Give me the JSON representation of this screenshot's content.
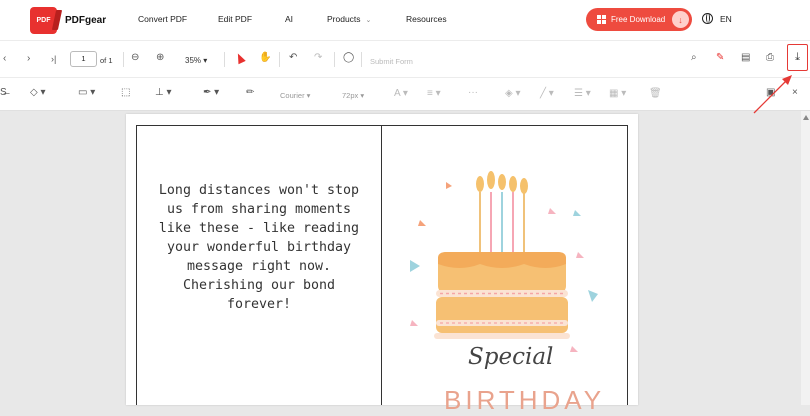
{
  "header": {
    "logo_icon_text": "PDF",
    "logo_text": "PDFgear",
    "nav": [
      "Convert PDF",
      "Edit PDF",
      "AI",
      "Products",
      "Resources"
    ],
    "download_label": "Free Download",
    "language": "EN",
    "accent_color": "#ee4b3f"
  },
  "viewer_toolbar": {
    "page_number": "1",
    "page_total": "of 1",
    "zoom": "35%",
    "submit_form_label": "Submit Form",
    "icons": [
      "back-arrow-icon",
      "forward-arrow-icon",
      "last-page-icon",
      "zoom-out-icon",
      "zoom-in-icon",
      "select-pointer-icon",
      "hand-icon",
      "undo-icon",
      "redo-icon",
      "comment-icon",
      "search-icon",
      "edit-icon",
      "page-view-icon",
      "print-icon",
      "download-icon"
    ]
  },
  "edit_toolbar": {
    "font_name": "Courier",
    "font_size": "72px",
    "icons": [
      "strikethrough-icon",
      "shape-icon",
      "textbox-icon",
      "crop-icon",
      "stamp-icon",
      "highlighter-icon",
      "pen-icon",
      "text-size-icon",
      "align-icon",
      "more-icon",
      "fill-color-icon",
      "line-color-icon",
      "line-width-icon",
      "opacity-icon",
      "delete-icon",
      "save-icon",
      "close-icon"
    ]
  },
  "document": {
    "message": "Long distances won't stop\nus from sharing moments\nlike these - like reading\nyour wonderful birthday\nmessage right now.\nCherishing our bond\nforever!",
    "card_title_script": "Special",
    "card_title_caps": "BIRTHDAY"
  }
}
